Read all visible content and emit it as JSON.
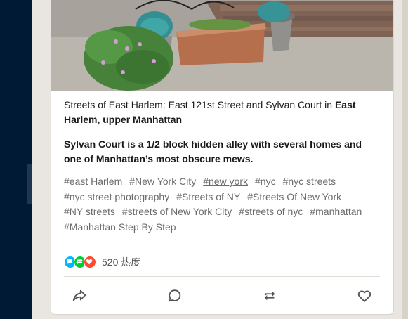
{
  "post": {
    "caption_prefix": "Streets of East Harlem: East 121st Street and Sylvan Court in ",
    "caption_bold": "East Harlem, upper Manhattan",
    "description": "Sylvan Court is a 1/2 block hidden alley with several homes and one of Manhattan’s most obscure mews.",
    "tags": [
      "#east Harlem",
      "#New York City",
      "#new york",
      "#nyc",
      "#nyc streets",
      "#nyc street photography",
      "#Streets of NY",
      "#Streets Of New York",
      "#NY streets",
      "#streets of New York City",
      "#streets of nyc",
      "#manhattan",
      "#Manhattan Step By Step"
    ],
    "notes_count": "520 热度"
  },
  "icons": {
    "note_comment": "comment-bubble-icon",
    "note_reblog": "reblog-icon",
    "note_like": "heart-icon",
    "share": "share-arrow-icon",
    "reply": "reply-bubble-icon",
    "reblog": "reblog-icon",
    "like": "heart-outline-icon"
  },
  "colors": {
    "sidebar": "#001935",
    "note_comment": "#00b8ff",
    "note_reblog": "#00cf35",
    "note_like": "#ff4930"
  }
}
